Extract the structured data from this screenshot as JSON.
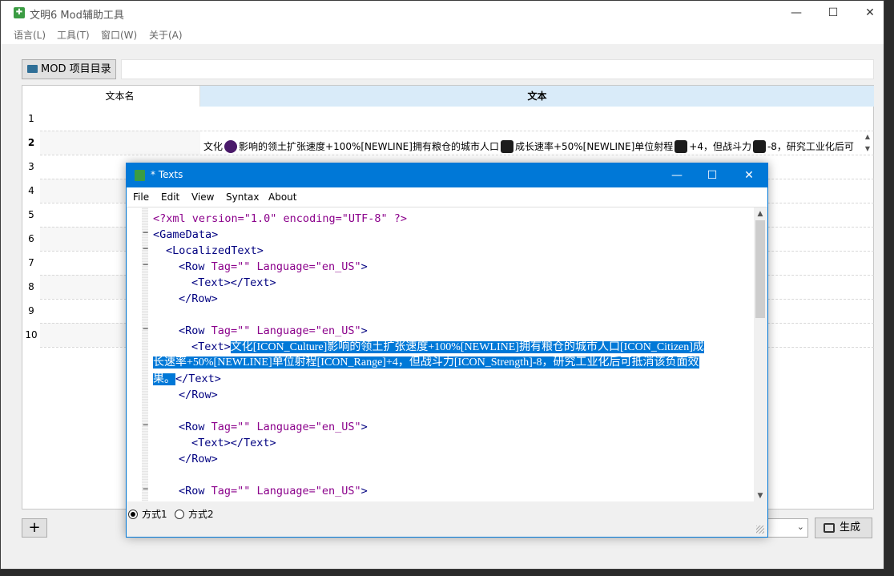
{
  "main_window": {
    "title": "文明6 Mod辅助工具",
    "controls": {
      "minimize": "—",
      "maximize": "☐",
      "close": "✕"
    },
    "menu": [
      "语言(L)",
      "工具(T)",
      "窗口(W)",
      "关于(A)"
    ],
    "mod_button_label": "MOD 项目目录",
    "path_value": "",
    "table": {
      "columns": [
        "文本名",
        "文本"
      ],
      "row_numbers": [
        "1",
        "2",
        "3",
        "4",
        "5",
        "6",
        "7",
        "8",
        "9",
        "10"
      ],
      "row2_text": {
        "part1": "文化",
        "part2": "影响的领土扩张速度+100%[NEWLINE]拥有粮仓的城市人口",
        "part3": "成长速率+50%[NEWLINE]单位射程",
        "part4": "+4，但战斗力",
        "part5": "-8，研究工业化后可"
      }
    },
    "add_button_label": "+",
    "generate_button_label": "生成",
    "combo_value": ""
  },
  "dialog": {
    "title": "* Texts",
    "controls": {
      "minimize": "—",
      "maximize": "☐",
      "close": "✕"
    },
    "menu": [
      "File",
      "Edit",
      "View",
      "Syntax",
      "About"
    ],
    "code": {
      "l1": "<?xml version=\"1.0\" encoding=\"UTF-8\" ?>",
      "l2": "<GameData>",
      "l3": "<LocalizedText>",
      "l4_tag": "<Row",
      "l4_attr1": " Tag=",
      "l4_val1": "\"\"",
      "l4_attr2": " Language=",
      "l4_val2": "\"en_US\"",
      "l4_end": ">",
      "l5": "<Text></Text>",
      "l6": "</Row>",
      "text_open": "<Text>",
      "sel1": "文化[ICON_Culture]影响的领土扩张速度+100%[NEWLINE]拥有粮仓的城市人口[ICON_Citizen]成",
      "sel2": "长速率+50%[NEWLINE]单位射程[ICON_Range]+4，但战斗力[ICON_Strength]-8，研究工业化后可抵消该负面效",
      "sel3": "果。",
      "text_close": "</Text>"
    },
    "radio_options": [
      "方式1",
      "方式2"
    ],
    "radio_selected": "方式1"
  }
}
